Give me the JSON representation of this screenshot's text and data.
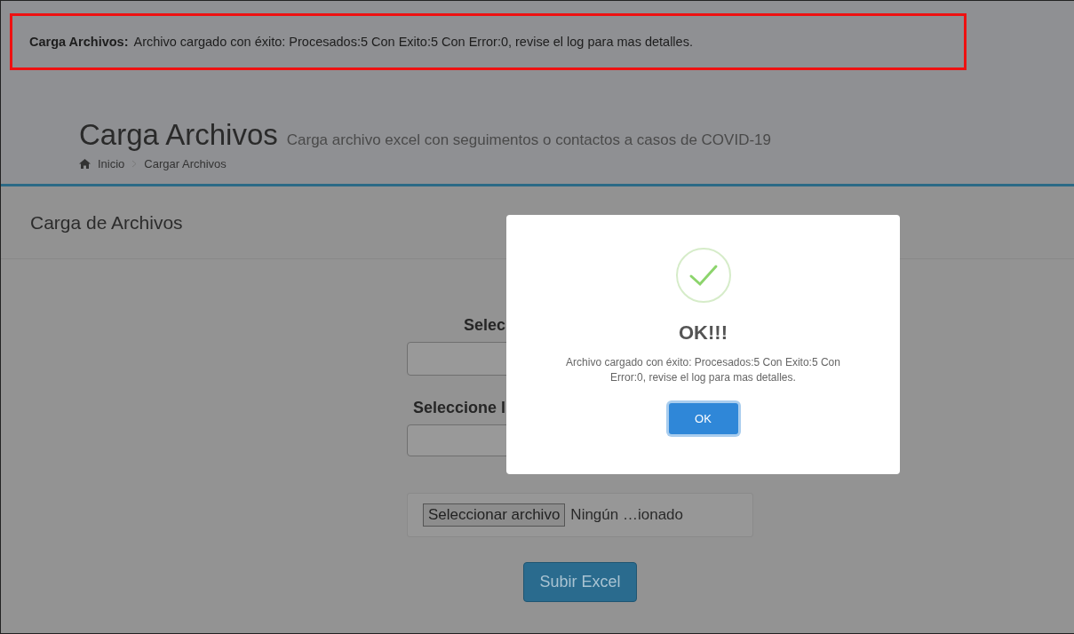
{
  "notification": {
    "title": "Carga Archivos:",
    "message": "Archivo cargado con éxito: Procesados:5 Con Exito:5 Con Error:0, revise el log para mas detalles."
  },
  "page_header": {
    "title": "Carga Archivos",
    "subtitle": "Carga archivo excel con seguimentos o contactos a casos de COVID-19",
    "breadcrumb": [
      "Inicio",
      "Cargar Archivos"
    ]
  },
  "panel": {
    "title": "Carga de Archivos",
    "fields": [
      {
        "label": "Selec"
      },
      {
        "label": "Seleccione l"
      }
    ],
    "file_input": {
      "button": "Seleccionar archivo",
      "status": "Ningún …ionado"
    },
    "submit": "Subir Excel"
  },
  "dialog": {
    "title": "OK!!!",
    "message": "Archivo cargado con éxito: Procesados:5 Con Exito:5 Con Error:0, revise el log para mas detalles.",
    "button": "OK"
  }
}
